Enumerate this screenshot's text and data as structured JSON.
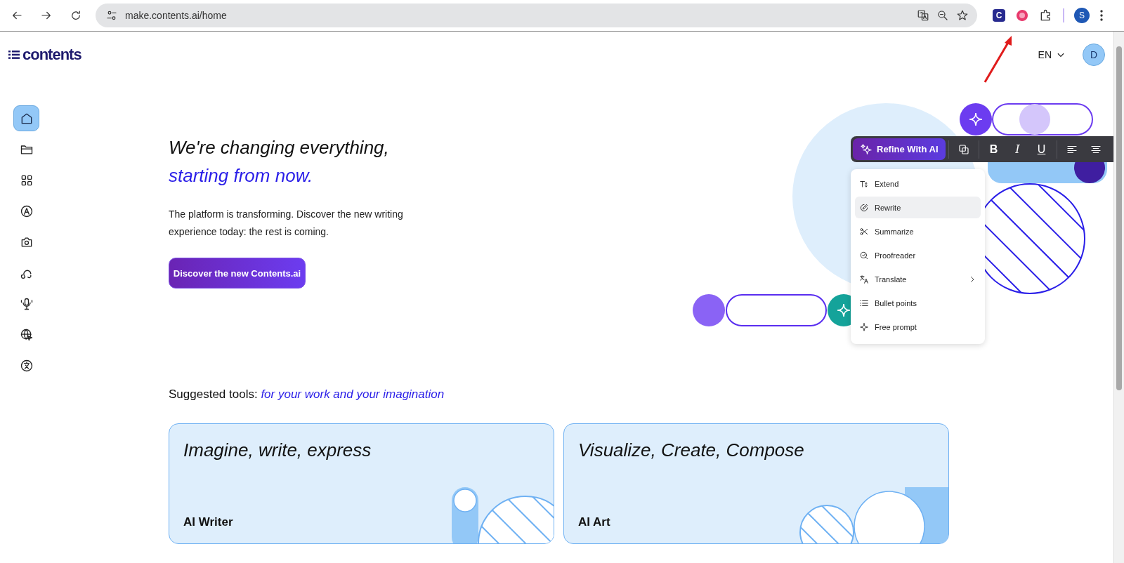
{
  "browser": {
    "url": "make.contents.ai/home",
    "extension_letter": "C",
    "profile_letter": "S"
  },
  "header": {
    "logo": "contents",
    "language": "EN",
    "avatar": "D"
  },
  "sidebar": {
    "items": [
      {
        "kind": "home",
        "selected": true
      },
      {
        "kind": "folder",
        "selected": false
      },
      {
        "kind": "grid",
        "selected": false
      },
      {
        "kind": "letter",
        "selected": false
      },
      {
        "kind": "camera",
        "selected": false
      },
      {
        "kind": "chat",
        "selected": false
      },
      {
        "kind": "mic",
        "selected": false
      },
      {
        "kind": "globe",
        "selected": false
      },
      {
        "kind": "translate",
        "selected": false
      }
    ]
  },
  "hero": {
    "title": "We're changing everything,",
    "title_accent": "starting from now.",
    "body": "The platform is transforming. Discover the new writing experience today: the rest is coming.",
    "button": "Discover the new Contents.ai"
  },
  "editor_toolbar": {
    "refine_button": "Refine With AI",
    "buttons": [
      {
        "kind": "copy"
      },
      {
        "kind": "bold",
        "label": "B"
      },
      {
        "kind": "italic",
        "label": "I"
      },
      {
        "kind": "underline",
        "label": "U"
      },
      {
        "kind": "align-left"
      },
      {
        "kind": "align-center"
      }
    ]
  },
  "refine_menu": {
    "items": [
      {
        "kind": "extend",
        "label": "Extend",
        "selected": false,
        "submenu": false
      },
      {
        "kind": "rewrite",
        "label": "Rewrite",
        "selected": true,
        "submenu": false
      },
      {
        "kind": "summarize",
        "label": "Summarize",
        "selected": false,
        "submenu": false
      },
      {
        "kind": "proofread",
        "label": "Proofreader",
        "selected": false,
        "submenu": false
      },
      {
        "kind": "translate",
        "label": "Translate",
        "selected": false,
        "submenu": true
      },
      {
        "kind": "bullets",
        "label": "Bullet points",
        "selected": false,
        "submenu": false
      },
      {
        "kind": "prompt",
        "label": "Free prompt",
        "selected": false,
        "submenu": false
      }
    ]
  },
  "suggested": {
    "label": "Suggested tools:",
    "accent": "for your work and your imagination"
  },
  "cards": [
    {
      "kind": "writer",
      "tagline": "Imagine, write, express",
      "name": "AI Writer"
    },
    {
      "kind": "art",
      "tagline": "Visualize, Create, Compose",
      "name": "AI Art"
    }
  ]
}
